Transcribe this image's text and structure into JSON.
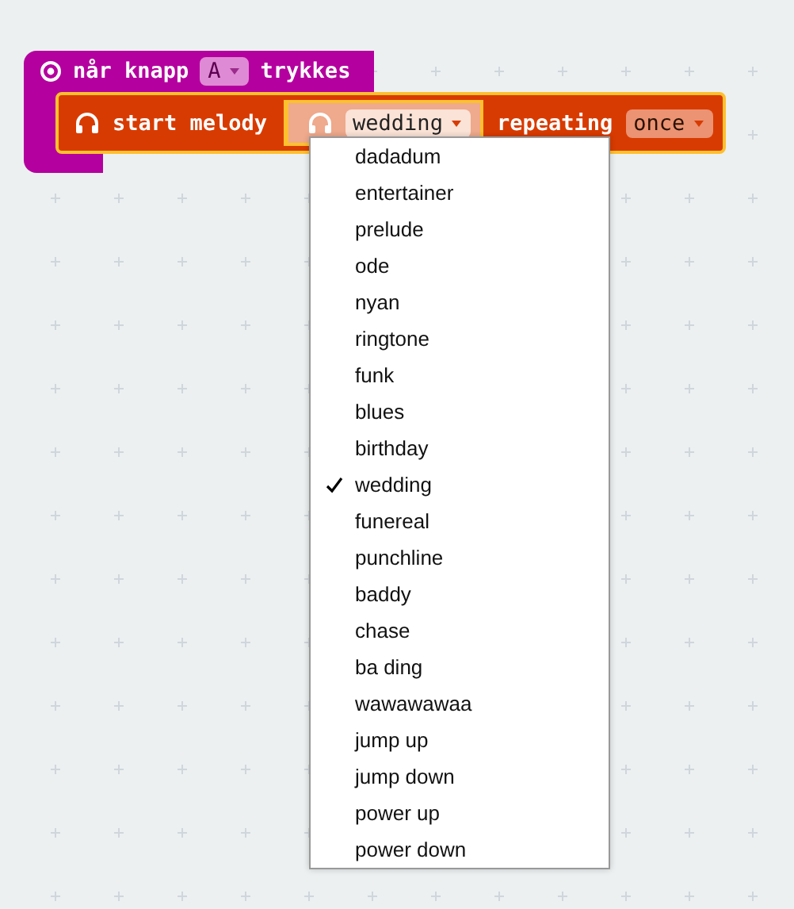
{
  "event_block": {
    "text_before": "når knapp",
    "button": "A",
    "text_after": "trykkes"
  },
  "melody_block": {
    "text": "start melody",
    "melody": "wedding",
    "repeat_text": "repeating",
    "repeat": "once"
  },
  "dropdown_menu": {
    "items": [
      {
        "label": "dadadum",
        "selected": false
      },
      {
        "label": "entertainer",
        "selected": false
      },
      {
        "label": "prelude",
        "selected": false
      },
      {
        "label": "ode",
        "selected": false
      },
      {
        "label": "nyan",
        "selected": false
      },
      {
        "label": "ringtone",
        "selected": false
      },
      {
        "label": "funk",
        "selected": false
      },
      {
        "label": "blues",
        "selected": false
      },
      {
        "label": "birthday",
        "selected": false
      },
      {
        "label": "wedding",
        "selected": true
      },
      {
        "label": "funereal",
        "selected": false
      },
      {
        "label": "punchline",
        "selected": false
      },
      {
        "label": "baddy",
        "selected": false
      },
      {
        "label": "chase",
        "selected": false
      },
      {
        "label": "ba ding",
        "selected": false
      },
      {
        "label": "wawawawaa",
        "selected": false
      },
      {
        "label": "jump up",
        "selected": false
      },
      {
        "label": "jump down",
        "selected": false
      },
      {
        "label": "power up",
        "selected": false
      },
      {
        "label": "power down",
        "selected": false
      }
    ]
  }
}
